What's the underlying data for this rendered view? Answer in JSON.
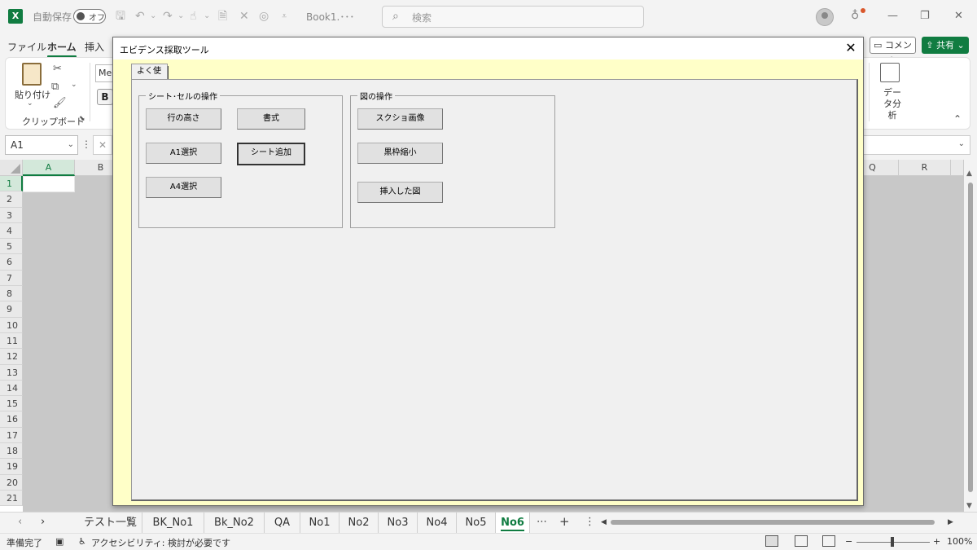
{
  "titlebar": {
    "autosave_label": "自動保存",
    "autosave_state": "オフ",
    "book_name": "Book1.･･･",
    "search_placeholder": "検索"
  },
  "ribbon": {
    "tabs": [
      "ファイル",
      "ホーム",
      "挿入"
    ],
    "active_tab": "ホーム",
    "comment_label": "コメント",
    "share_label": "共有",
    "paste_label": "貼り付け",
    "clipboard_label": "クリップボード",
    "font_name": "Mei",
    "bold_label": "B",
    "data_analysis_label": "データ分析"
  },
  "formula_bar": {
    "name_box": "A1"
  },
  "grid": {
    "columns_left": [
      "A",
      "B"
    ],
    "columns_right": [
      "Q",
      "R"
    ],
    "rows": [
      "1",
      "2",
      "3",
      "4",
      "5",
      "6",
      "7",
      "8",
      "9",
      "10",
      "11",
      "12",
      "13",
      "14",
      "15",
      "16",
      "17",
      "18",
      "19",
      "20",
      "21"
    ],
    "selected_column": "A",
    "selected_row": "1"
  },
  "dialog": {
    "title": "エビデンス採取ツール",
    "close_label": "✕",
    "tab_label": "よく使う",
    "frame_sheet": {
      "title": "シート･セルの操作",
      "buttons": [
        "行の高さ",
        "書式",
        "A1選択",
        "シート追加",
        "A4選択"
      ]
    },
    "frame_figure": {
      "title": "図の操作",
      "buttons": [
        "スクショ画像",
        "黒枠縮小",
        "挿入した図"
      ]
    }
  },
  "sheet_tabs": {
    "tabs": [
      "テスト一覧",
      "BK_No1",
      "Bk_No2",
      "QA",
      "No1",
      "No2",
      "No3",
      "No4",
      "No5",
      "No6"
    ],
    "active": "No6"
  },
  "status_bar": {
    "ready": "準備完了",
    "accessibility": "アクセシビリティ: 検討が必要です",
    "zoom": "100%"
  },
  "colors": {
    "excel_green": "#107c41",
    "dialog_background": "#ffffc8",
    "form_background": "#f0f0f0"
  }
}
